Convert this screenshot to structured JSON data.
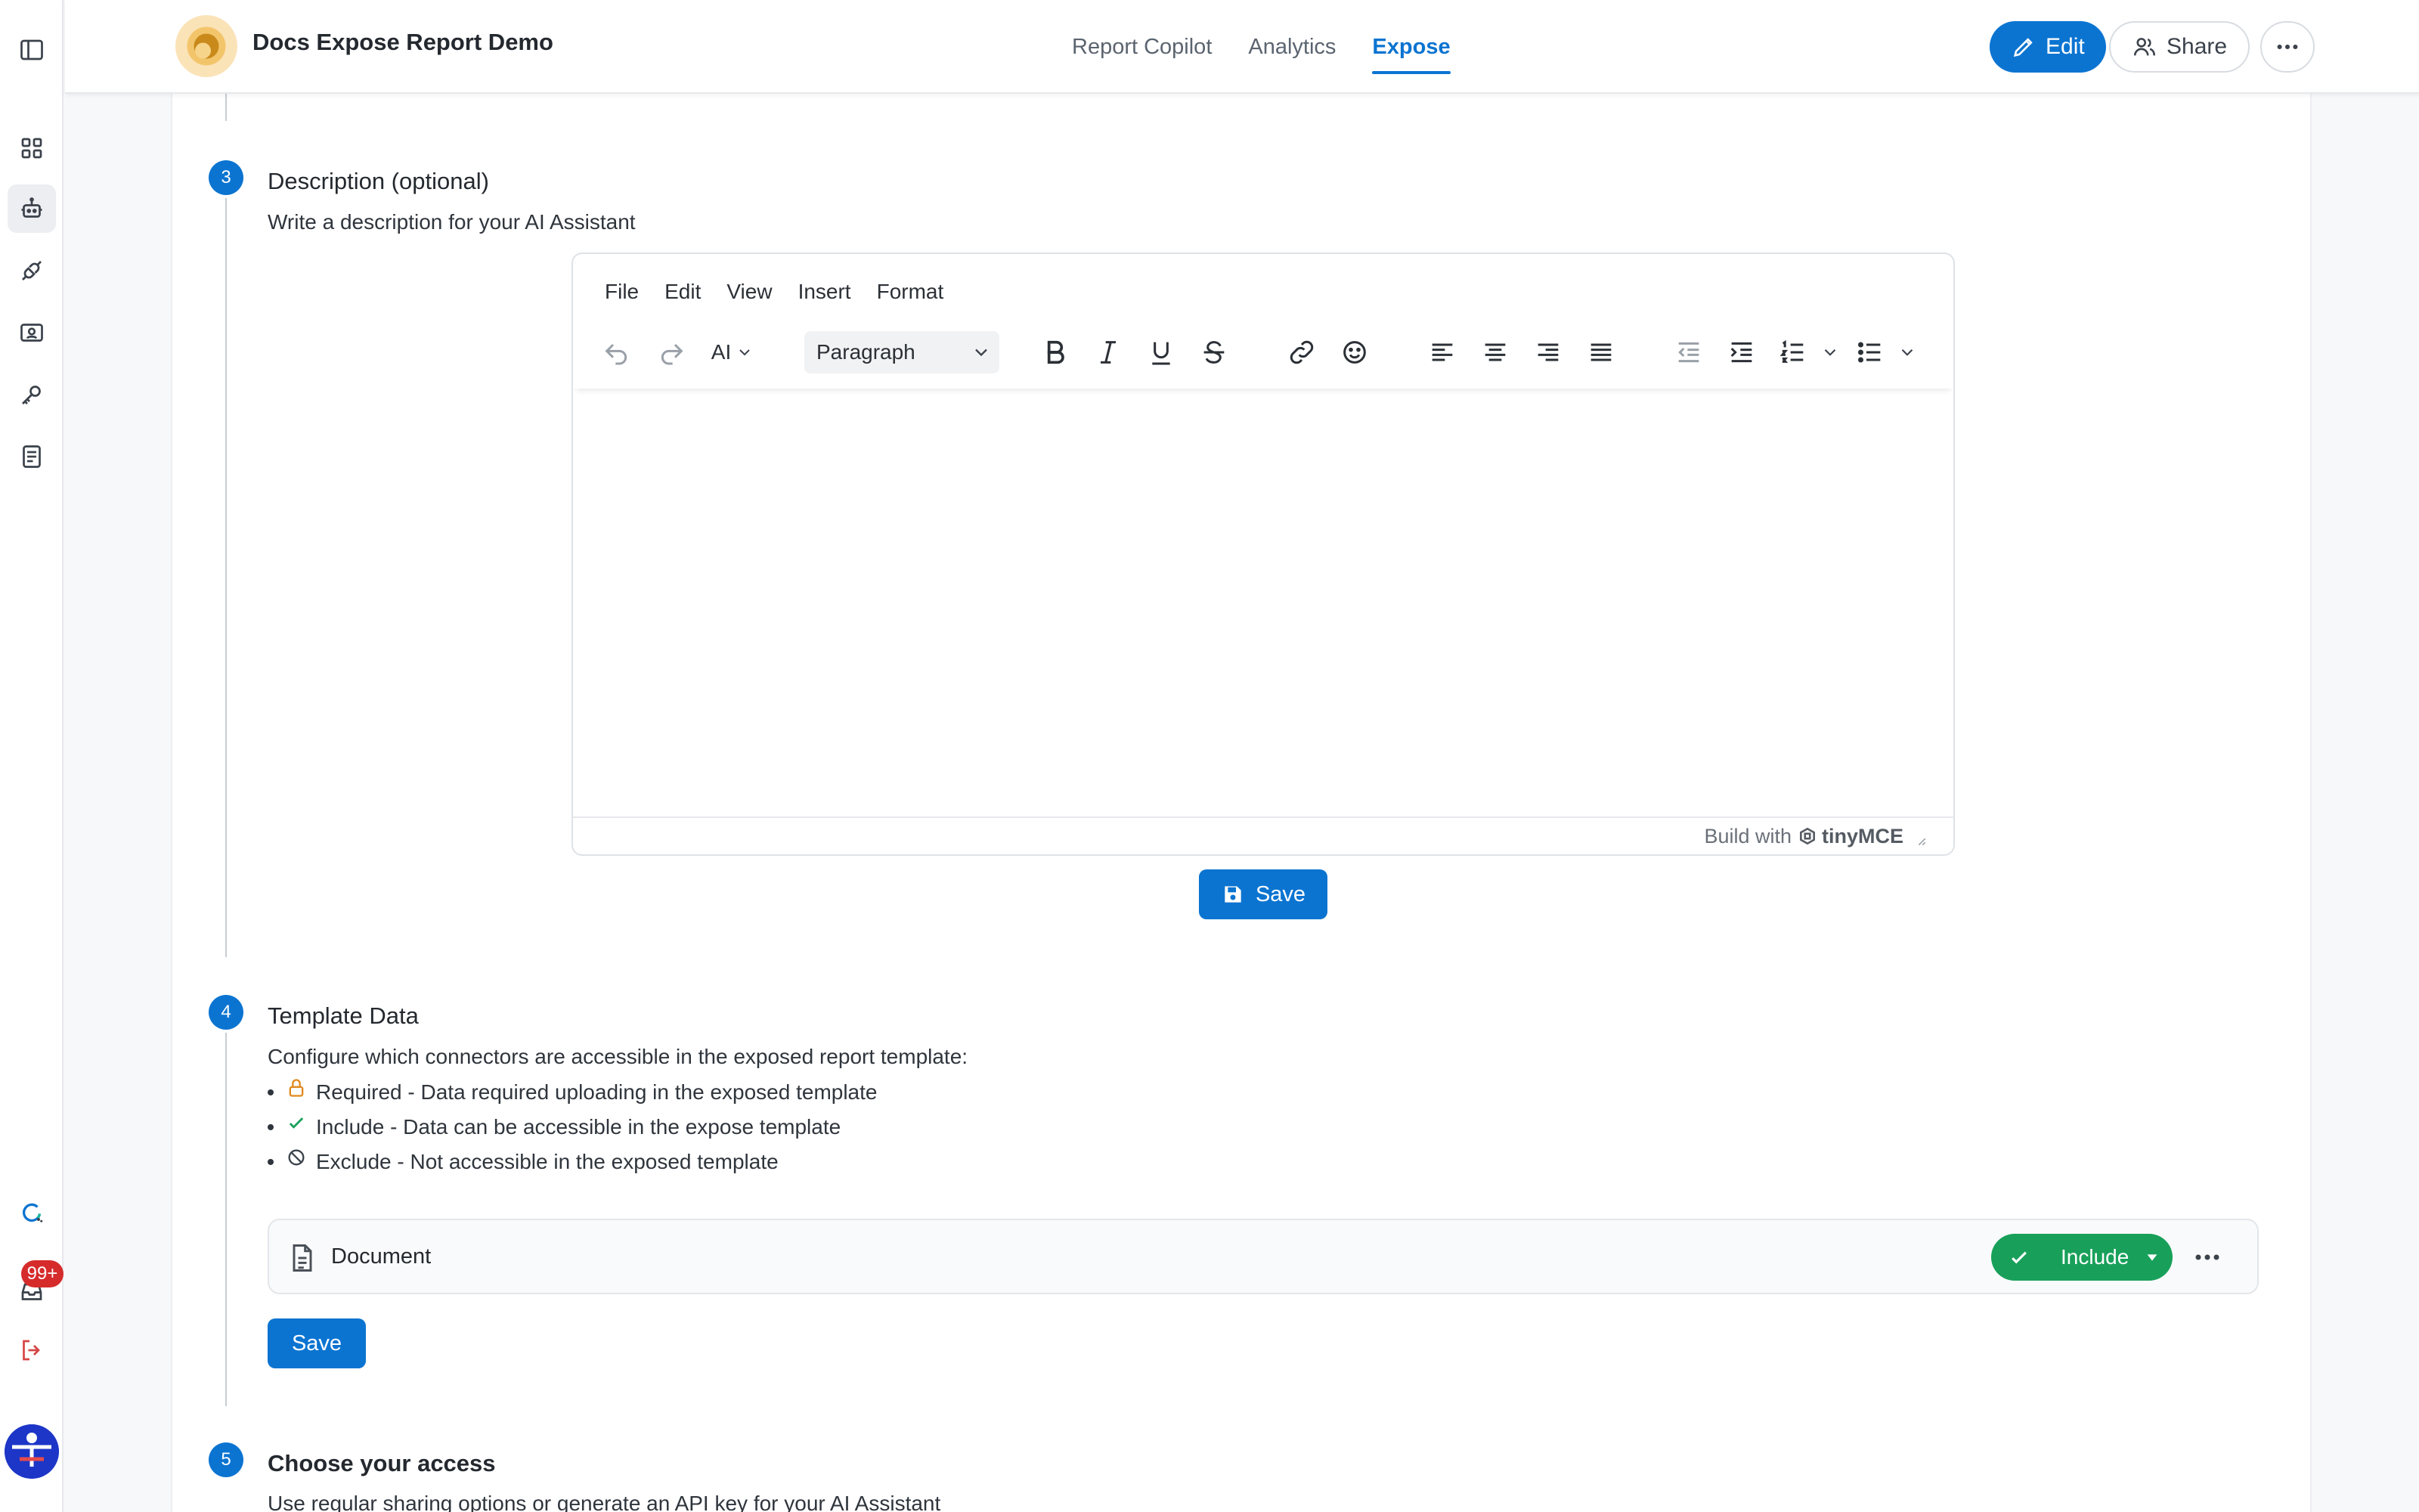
{
  "app": {
    "title": "Docs Expose Report Demo"
  },
  "nav": {
    "tabs": [
      {
        "label": "Report Copilot"
      },
      {
        "label": "Analytics"
      },
      {
        "label": "Expose",
        "active": true
      }
    ]
  },
  "header_actions": {
    "edit_label": "Edit",
    "share_label": "Share"
  },
  "rail": {
    "items": [
      "sidebar-toggle-icon",
      "dashboard-icon",
      "bot-icon",
      "plug-icon",
      "scan-icon",
      "key-icon",
      "book-icon",
      "support-icon",
      "inbox-icon",
      "logout-icon"
    ],
    "notification_badge": "99+"
  },
  "steps": {
    "description": {
      "number": "3",
      "title": "Description (optional)",
      "subtitle": "Write a description for your AI Assistant",
      "save_label": "Save"
    },
    "template_data": {
      "number": "4",
      "title": "Template Data",
      "subtitle": "Configure which connectors are accessible in the exposed report template:",
      "legend": [
        {
          "icon": "lock-icon",
          "text": "Required - Data required uploading in the exposed template"
        },
        {
          "icon": "check-icon",
          "text": "Include - Data can be accessible in the expose template"
        },
        {
          "icon": "ban-icon",
          "text": "Exclude - Not accessible in the exposed template"
        }
      ],
      "connector": {
        "name": "Document",
        "status": "Include"
      },
      "save_label": "Save"
    },
    "access": {
      "number": "5",
      "title": "Choose your access",
      "subtitle": "Use regular sharing options or generate an API key for your AI Assistant"
    }
  },
  "editor": {
    "menu": [
      "File",
      "Edit",
      "View",
      "Insert",
      "Format"
    ],
    "ai_label": "AI",
    "block_format": "Paragraph",
    "footer_text": "Build with",
    "brand": "tinyMCE"
  },
  "colors": {
    "accent": "#0b74d1",
    "success": "#18a05a",
    "badge": "#d62b2b"
  }
}
